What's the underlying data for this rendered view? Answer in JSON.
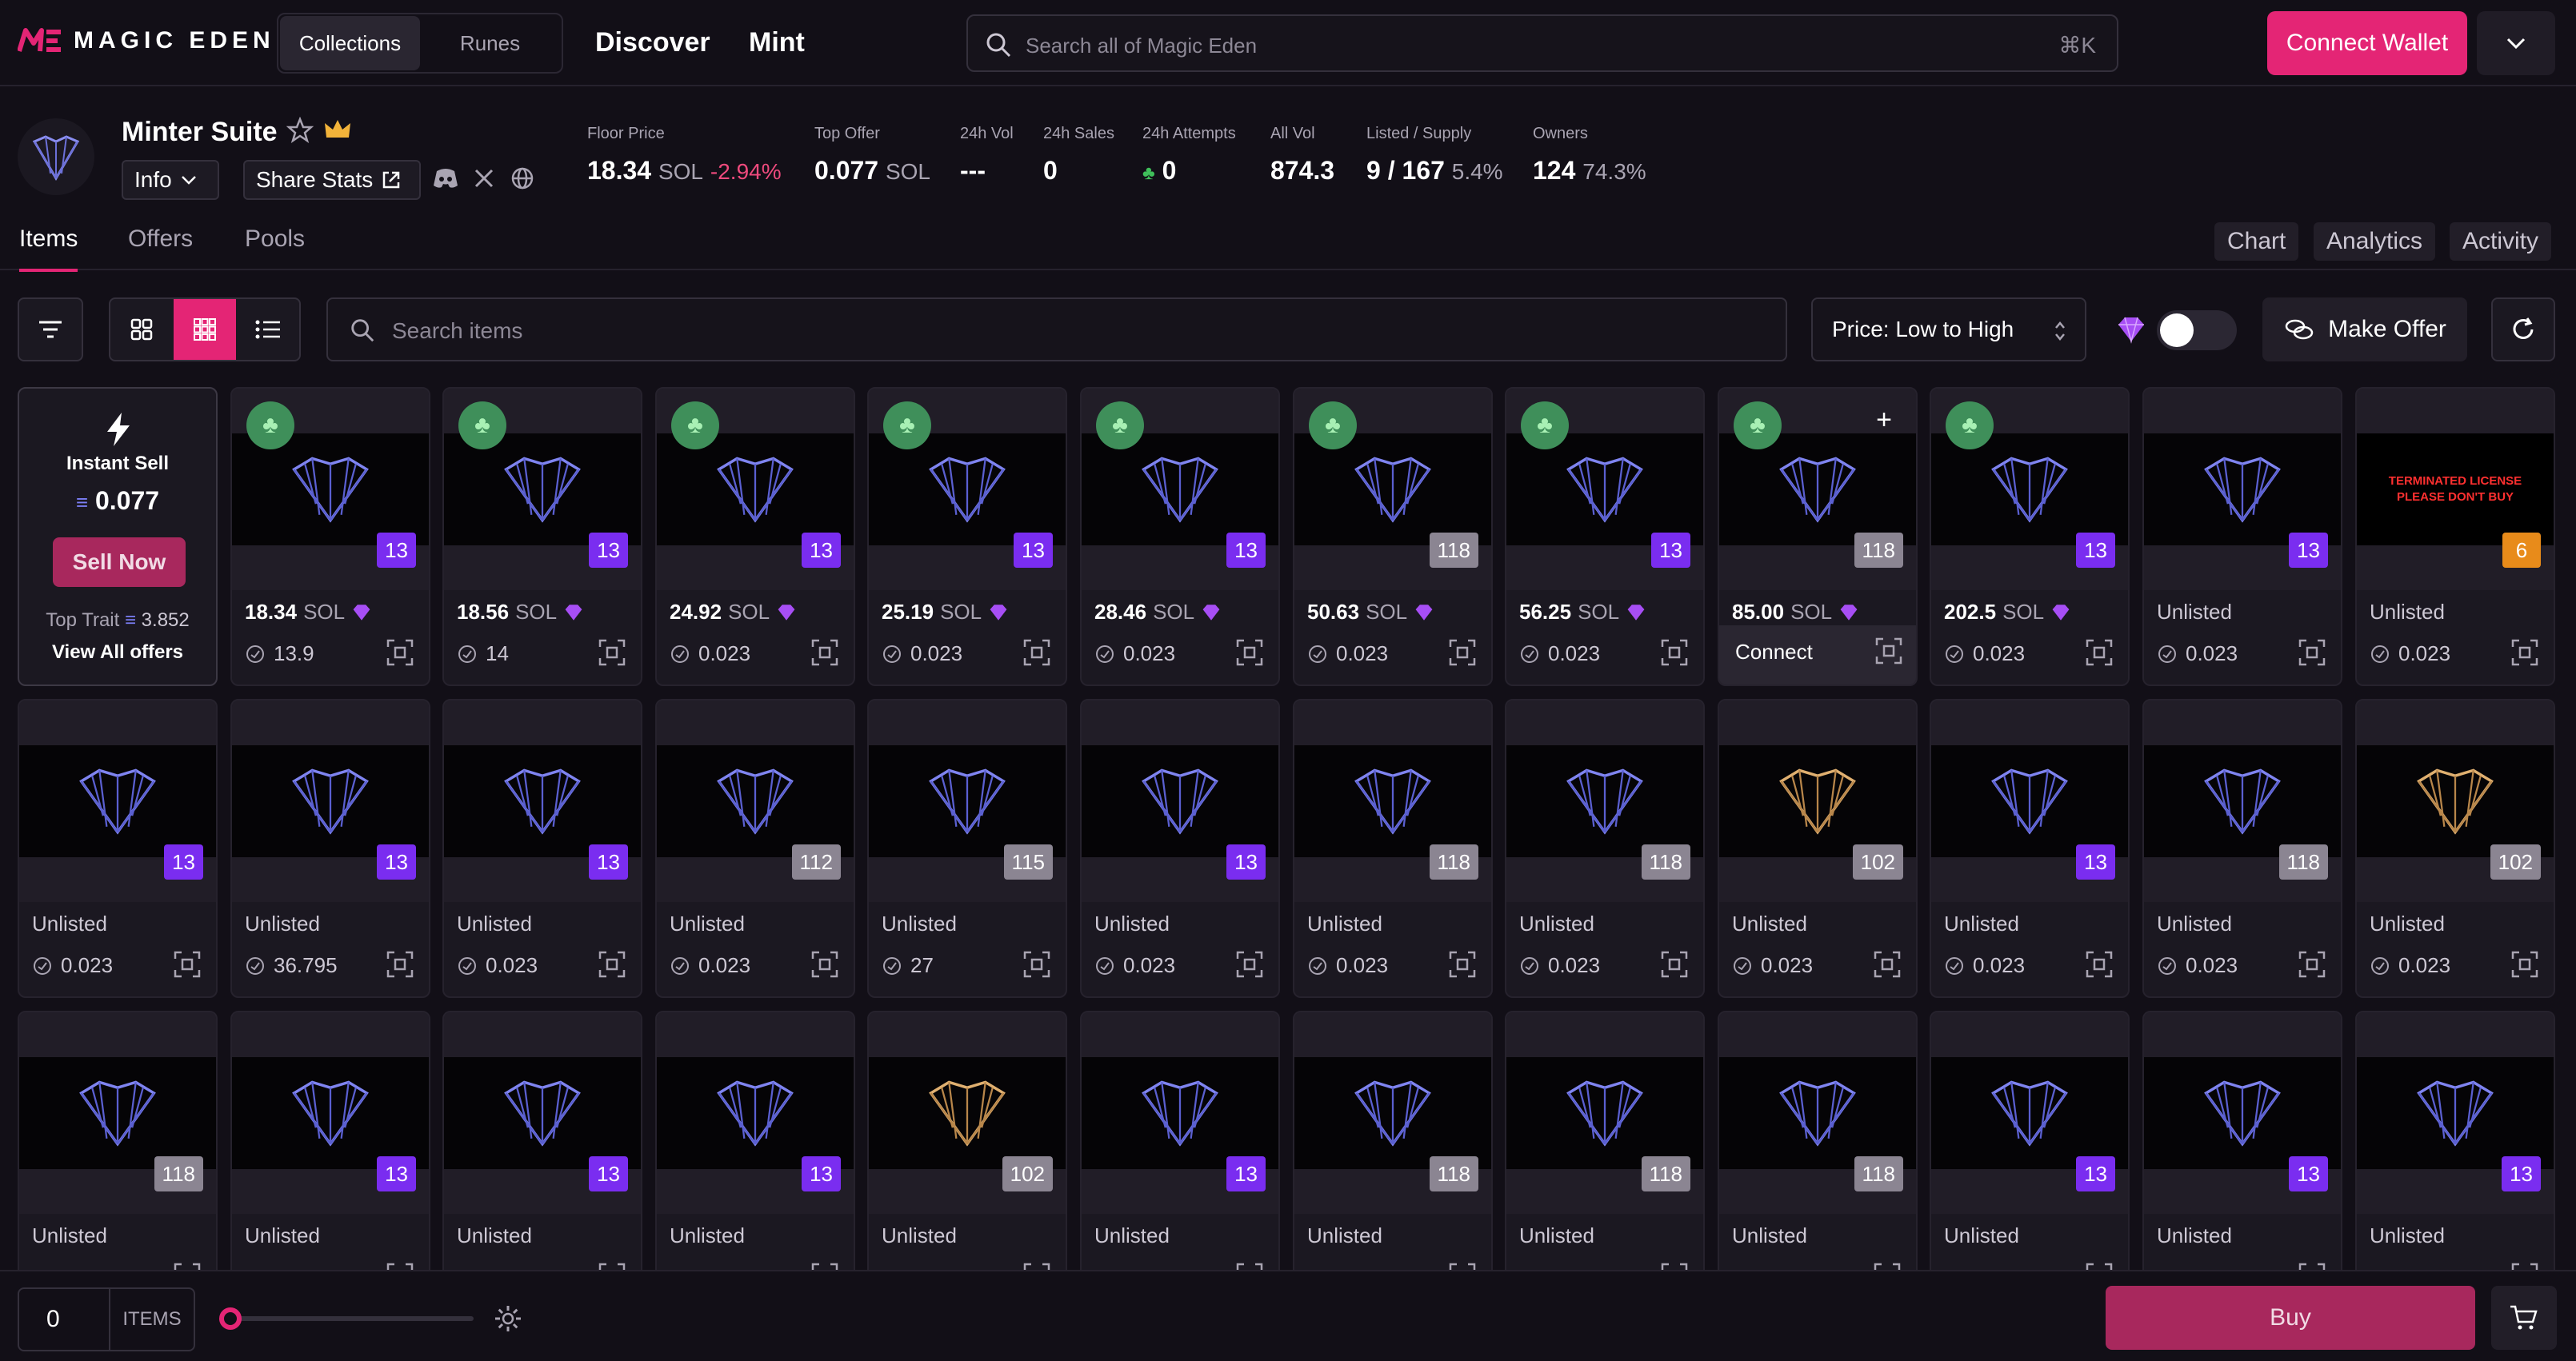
{
  "brand": {
    "logo_text": "MAGIC EDEN",
    "accent": "#e42575"
  },
  "topbar": {
    "tabs": [
      {
        "label": "Collections",
        "active": true
      },
      {
        "label": "Runes",
        "active": false
      }
    ],
    "nav": [
      "Discover",
      "Mint"
    ],
    "search_placeholder": "Search all of Magic Eden",
    "search_shortcut": "⌘K",
    "connect_label": "Connect Wallet"
  },
  "collection": {
    "name": "Minter Suite",
    "info_label": "Info",
    "share_label": "Share Stats",
    "stats": [
      {
        "label": "Floor Price",
        "value": "18.34",
        "unit": "SOL",
        "change": "-2.94%"
      },
      {
        "label": "Top Offer",
        "value": "0.077",
        "unit": "SOL"
      },
      {
        "label": "24h Vol",
        "value": "---"
      },
      {
        "label": "24h Sales",
        "value": "0"
      },
      {
        "label": "24h Attempts",
        "value": "0"
      },
      {
        "label": "All Vol",
        "value": "874.3"
      },
      {
        "label": "Listed / Supply",
        "value": "9 / 167",
        "extra": "5.4%"
      },
      {
        "label": "Owners",
        "value": "124",
        "extra": "74.3%"
      }
    ]
  },
  "page_tabs": [
    {
      "label": "Items",
      "active": true
    },
    {
      "label": "Offers",
      "active": false
    },
    {
      "label": "Pools",
      "active": false
    }
  ],
  "right_tabs": [
    "Chart",
    "Analytics",
    "Activity"
  ],
  "toolbar": {
    "search_placeholder": "Search items",
    "sort_label": "Price: Low to High",
    "make_offer_label": "Make Offer"
  },
  "instant_sell": {
    "title": "Instant Sell",
    "amount": "0.077",
    "sell_label": "Sell Now",
    "top_trait_label": "Top Trait",
    "top_trait_value": "3.852",
    "view_all_label": "View All offers"
  },
  "cards": [
    {
      "badge": "13",
      "badge_color": "purple",
      "clover": true,
      "price": "18.34",
      "unit": "SOL",
      "offer": "13.9"
    },
    {
      "badge": "13",
      "badge_color": "purple",
      "clover": true,
      "price": "18.56",
      "unit": "SOL",
      "offer": "14"
    },
    {
      "badge": "13",
      "badge_color": "purple",
      "clover": true,
      "price": "24.92",
      "unit": "SOL",
      "offer": "0.023"
    },
    {
      "badge": "13",
      "badge_color": "purple",
      "clover": true,
      "price": "25.19",
      "unit": "SOL",
      "offer": "0.023"
    },
    {
      "badge": "13",
      "badge_color": "purple",
      "clover": true,
      "price": "28.46",
      "unit": "SOL",
      "offer": "0.023"
    },
    {
      "badge": "118",
      "badge_color": "gray",
      "clover": true,
      "price": "50.63",
      "unit": "SOL",
      "offer": "0.023"
    },
    {
      "badge": "13",
      "badge_color": "purple",
      "clover": true,
      "price": "56.25",
      "unit": "SOL",
      "offer": "0.023"
    },
    {
      "badge": "118",
      "badge_color": "gray",
      "clover": true,
      "price": "85.00",
      "unit": "SOL",
      "offer": "",
      "hover": true,
      "connect_label": "Connect"
    },
    {
      "badge": "13",
      "badge_color": "purple",
      "clover": true,
      "price": "202.5",
      "unit": "SOL",
      "offer": "0.023"
    },
    {
      "badge": "13",
      "badge_color": "purple",
      "status": "Unlisted",
      "offer": "0.023"
    },
    {
      "badge": "6",
      "badge_color": "orange",
      "status": "Unlisted",
      "offer": "0.023",
      "terminated_text": "TERMINATED LICENSE PLEASE DON'T BUY"
    },
    {
      "badge": "13",
      "badge_color": "purple",
      "status": "Unlisted",
      "offer": "0.023"
    },
    {
      "badge": "13",
      "badge_color": "purple",
      "status": "Unlisted",
      "offer": "36.795"
    },
    {
      "badge": "13",
      "badge_color": "purple",
      "status": "Unlisted",
      "offer": "0.023"
    },
    {
      "badge": "112",
      "badge_color": "gray",
      "status": "Unlisted",
      "offer": "0.023"
    },
    {
      "badge": "115",
      "badge_color": "gray",
      "status": "Unlisted",
      "offer": "27"
    },
    {
      "badge": "13",
      "badge_color": "purple",
      "status": "Unlisted",
      "offer": "0.023"
    },
    {
      "badge": "118",
      "badge_color": "gray",
      "status": "Unlisted",
      "offer": "0.023"
    },
    {
      "badge": "118",
      "badge_color": "gray",
      "status": "Unlisted",
      "offer": "0.023"
    },
    {
      "badge": "102",
      "badge_color": "gray",
      "status": "Unlisted",
      "offer": "0.023",
      "gold": true
    },
    {
      "badge": "13",
      "badge_color": "purple",
      "status": "Unlisted",
      "offer": "0.023"
    },
    {
      "badge": "118",
      "badge_color": "gray",
      "status": "Unlisted",
      "offer": "0.023"
    },
    {
      "badge": "102",
      "badge_color": "gray",
      "status": "Unlisted",
      "offer": "0.023",
      "gold": true
    },
    {
      "badge": "118",
      "badge_color": "gray",
      "status": "Unlisted"
    },
    {
      "badge": "13",
      "badge_color": "purple",
      "status": "Unlisted"
    },
    {
      "badge": "13",
      "badge_color": "purple",
      "status": "Unlisted"
    },
    {
      "badge": "13",
      "badge_color": "purple",
      "status": "Unlisted"
    },
    {
      "badge": "102",
      "badge_color": "gray",
      "status": "Unlisted",
      "gold": true
    },
    {
      "badge": "13",
      "badge_color": "purple",
      "status": "Unlisted"
    },
    {
      "badge": "118",
      "badge_color": "gray",
      "status": "Unlisted"
    },
    {
      "badge": "118",
      "badge_color": "gray",
      "status": "Unlisted"
    },
    {
      "badge": "118",
      "badge_color": "gray",
      "status": "Unlisted"
    },
    {
      "badge": "13",
      "badge_color": "purple",
      "status": "Unlisted"
    },
    {
      "badge": "13",
      "badge_color": "purple",
      "status": "Unlisted"
    },
    {
      "badge": "13",
      "badge_color": "purple",
      "status": "Unlisted"
    }
  ],
  "bottombar": {
    "quantity": "0",
    "items_label": "ITEMS",
    "buy_label": "Buy"
  }
}
